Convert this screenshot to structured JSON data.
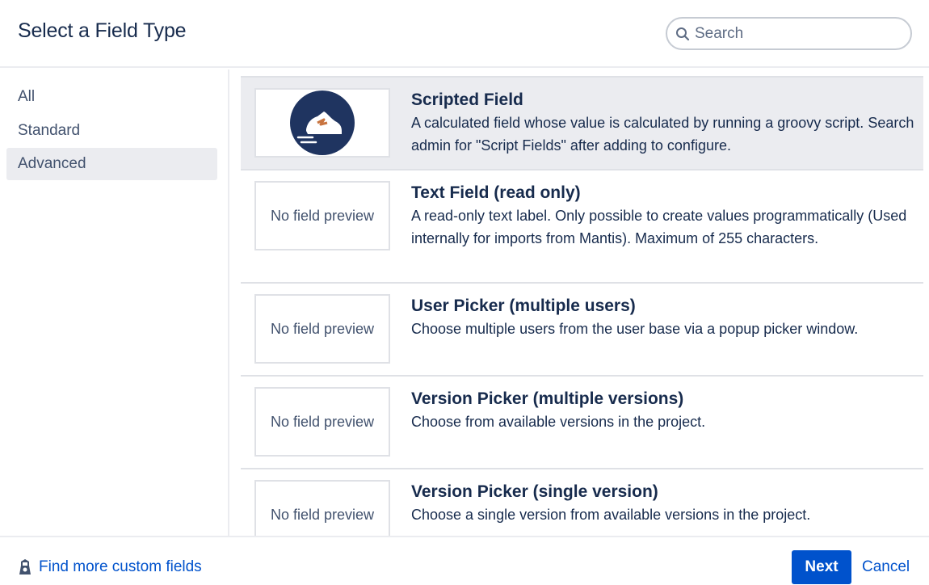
{
  "dialog": {
    "title": "Select a Field Type"
  },
  "search": {
    "placeholder": "Search",
    "value": ""
  },
  "sidebar": {
    "items": [
      {
        "label": "All"
      },
      {
        "label": "Standard"
      },
      {
        "label": "Advanced",
        "active": true
      }
    ]
  },
  "fields": [
    {
      "name": "Scripted Field",
      "description": "A calculated field whose value is calculated by running a groovy script. Search admin for \"Script Fields\" after adding to configure.",
      "preview": "shoe-logo-icon",
      "selected": true
    },
    {
      "name": "Text Field (read only)",
      "description": "A read-only text label. Only possible to create values programmatically (Used internally for imports from Mantis). Maximum of 255 characters.",
      "preview_text": "No field preview"
    },
    {
      "name": "User Picker (multiple users)",
      "description": "Choose multiple users from the user base via a popup picker window.",
      "preview_text": "No field preview"
    },
    {
      "name": "Version Picker (multiple versions)",
      "description": "Choose from available versions in the project.",
      "preview_text": "No field preview"
    },
    {
      "name": "Version Picker (single version)",
      "description": "Choose a single version from available versions in the project.",
      "preview_text": "No field preview"
    }
  ],
  "footer": {
    "find_more_label": "Find more custom fields",
    "next_label": "Next",
    "cancel_label": "Cancel"
  },
  "colors": {
    "primary": "#0052cc",
    "text": "#172b4d",
    "selected_bg": "#ebecf0",
    "logo_bg": "#1f3460",
    "logo_accent": "#c8743f"
  }
}
